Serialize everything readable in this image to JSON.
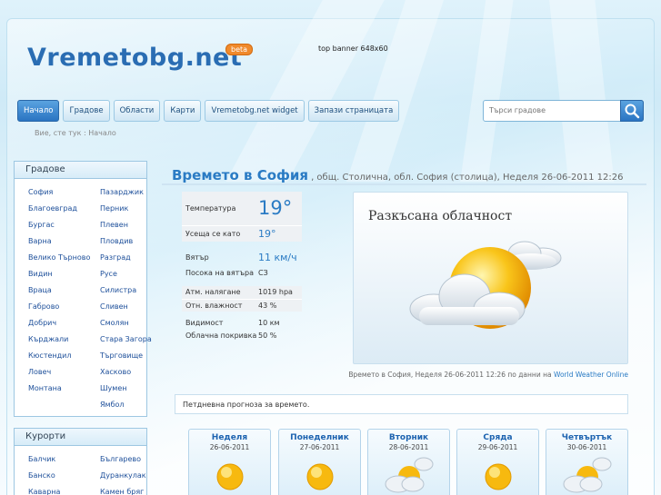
{
  "site": {
    "logo": "Vremetobg.net",
    "badge": "beta",
    "top_banner": "top banner 648x60"
  },
  "nav": [
    "Начало",
    "Градове",
    "Области",
    "Карти",
    "Vremetobg.net widget",
    "Запази страницата"
  ],
  "search": {
    "placeholder": "Търси градове"
  },
  "breadcrumb": "Вие, сте тук : Начало",
  "cities_box": {
    "title": "Градове",
    "col1": [
      "София",
      "Благоевград",
      "Бургас",
      "Варна",
      "Велико Търново",
      "Видин",
      "Враца",
      "Габрово",
      "Добрич",
      "Кърджали",
      "Кюстендил",
      "Ловеч",
      "Монтана"
    ],
    "col2": [
      "Пазарджик",
      "Перник",
      "Плевен",
      "Пловдив",
      "Разград",
      "Русе",
      "Силистра",
      "Сливен",
      "Смолян",
      "Стара Загора",
      "Търговище",
      "Хасково",
      "Шумен",
      "Ямбол"
    ]
  },
  "resorts_box": {
    "title": "Курорти",
    "col1": [
      "Балчик",
      "Банско",
      "Каварна"
    ],
    "col2": [
      "Българево",
      "Дуранкулак",
      "Камен бряг"
    ]
  },
  "heading": {
    "title": "Времето в София",
    "details": ", общ. Столична, обл. София (столица), Неделя 26-06-2011 12:26"
  },
  "current": {
    "temp_label": "Температура",
    "temp": "19°",
    "feels_label": "Усеща се като",
    "feels": "19°",
    "wind_label": "Вятър",
    "wind": "11 км/ч",
    "wind_dir_label": "Посока на вятъра",
    "wind_dir": "СЗ",
    "pressure_label": "Атм. налягане",
    "pressure": "1019 hpa",
    "humidity_label": "Отн. влажност",
    "humidity": "43 %",
    "visibility_label": "Видимост",
    "visibility": "10 км",
    "cloud_label": "Облачна покривка",
    "cloud": "50 %"
  },
  "condition": "Разкъсана облачност",
  "source": {
    "text": "Времето в София, Неделя 26-06-2011 12:26 по данни на ",
    "link": "World Weather Online"
  },
  "forecast_title": "Петдневна прогноза за времето.",
  "forecast": [
    {
      "day": "Неделя",
      "date": "26-06-2011",
      "icon": "sun-icon"
    },
    {
      "day": "Понеделник",
      "date": "27-06-2011",
      "icon": "sun-icon"
    },
    {
      "day": "Вторник",
      "date": "28-06-2011",
      "icon": "rain-cloud-icon"
    },
    {
      "day": "Сряда",
      "date": "29-06-2011",
      "icon": "sun-icon"
    },
    {
      "day": "Четвъртък",
      "date": "30-06-2011",
      "icon": "rain-cloud-icon"
    }
  ],
  "colors": {
    "accent": "#2a7bc4",
    "link": "#1d4f9a",
    "badge": "#f08a2c"
  }
}
